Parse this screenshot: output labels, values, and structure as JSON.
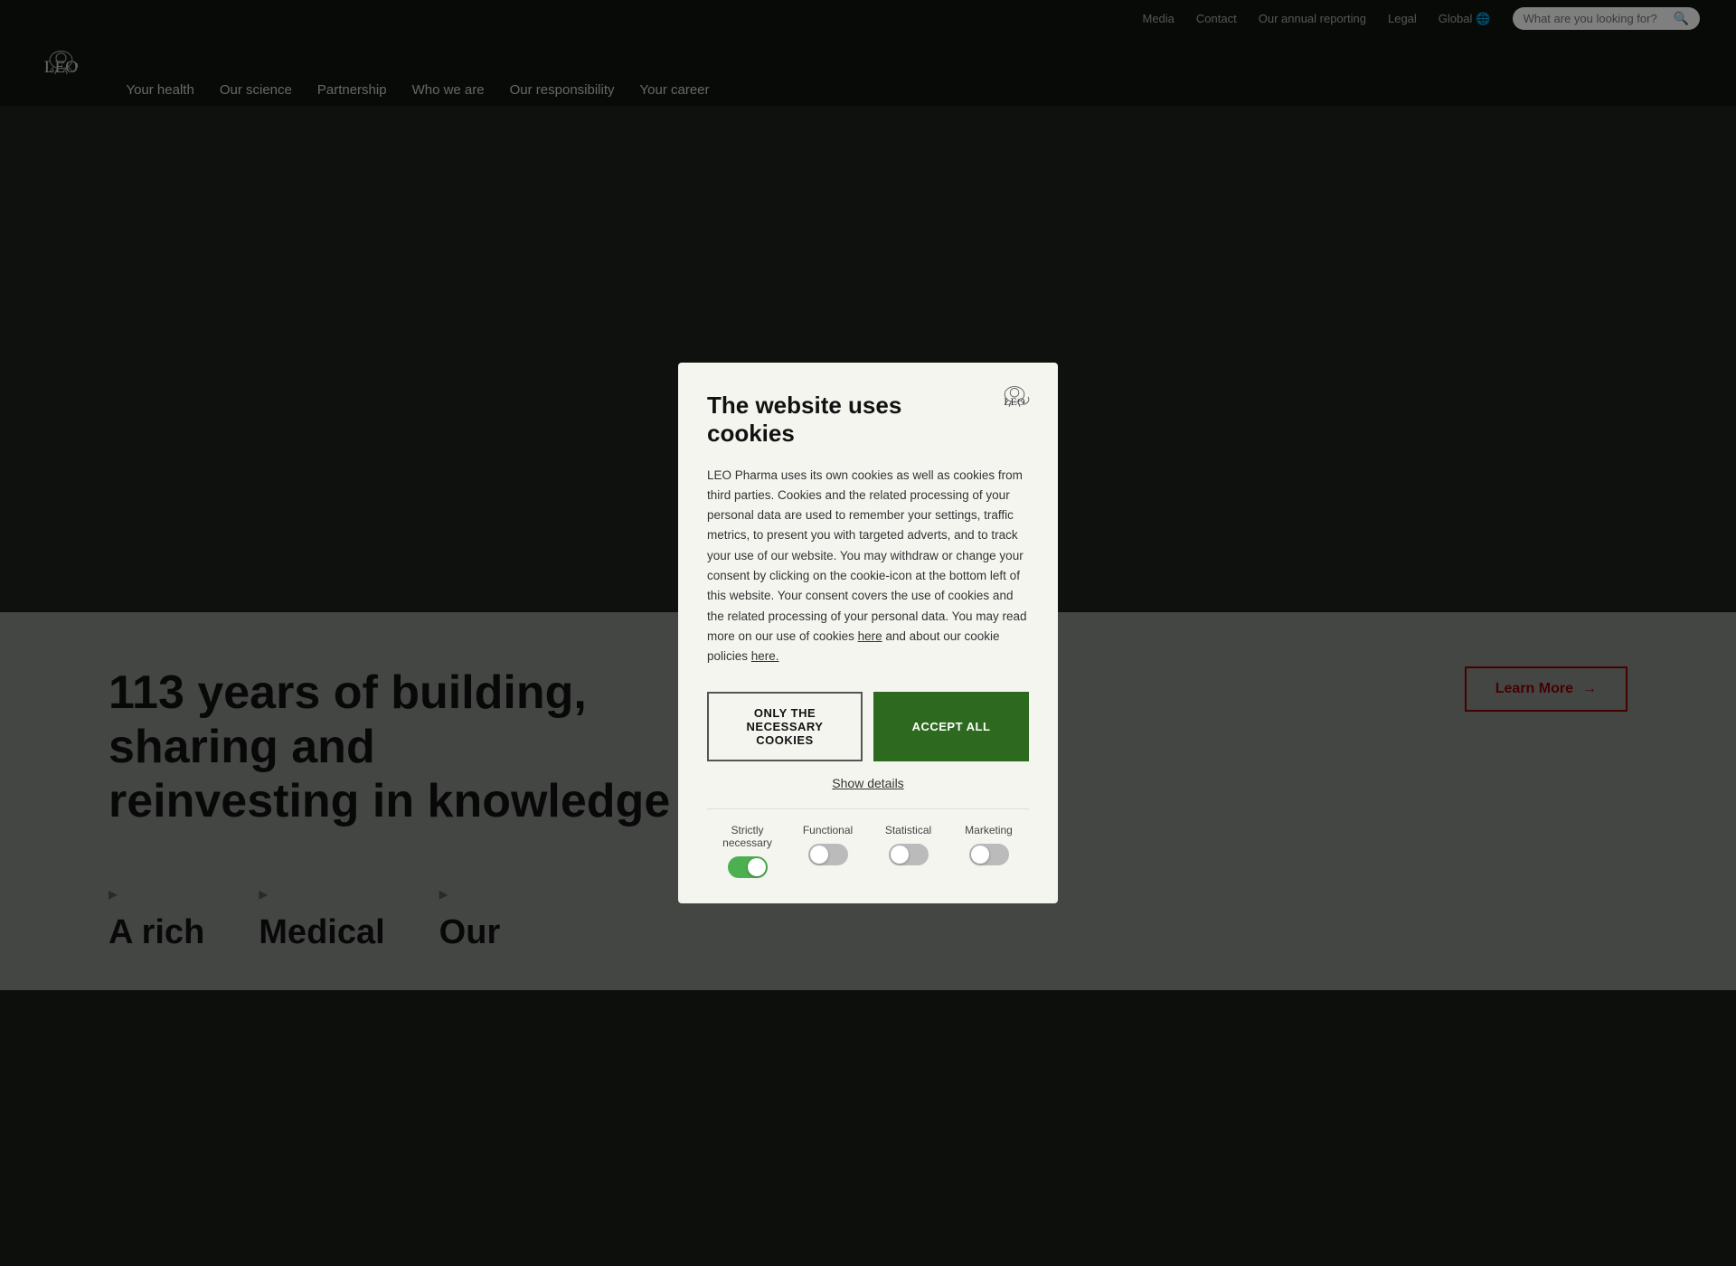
{
  "topbar": {
    "links": [
      {
        "label": "Media",
        "key": "media"
      },
      {
        "label": "Contact",
        "key": "contact"
      },
      {
        "label": "Our annual reporting",
        "key": "annual-reporting"
      },
      {
        "label": "Legal",
        "key": "legal"
      },
      {
        "label": "Global",
        "key": "global"
      }
    ],
    "search_placeholder": "What are you looking for?"
  },
  "nav": {
    "links": [
      {
        "label": "Your health",
        "key": "your-health"
      },
      {
        "label": "Our science",
        "key": "our-science"
      },
      {
        "label": "Partnership",
        "key": "partnership"
      },
      {
        "label": "Who we are",
        "key": "who-we-are"
      },
      {
        "label": "Our responsibility",
        "key": "our-responsibility"
      },
      {
        "label": "Your career",
        "key": "your-career"
      }
    ]
  },
  "cookie_modal": {
    "title": "The website uses cookies",
    "body": "LEO Pharma uses its own cookies as well as cookies from third parties. Cookies and the related processing of your personal data are used to remember your settings, traffic metrics, to present you with targeted adverts, and to track your use of our website. You may withdraw or change your consent by clicking on the cookie-icon at the bottom left of this website. Your consent covers the use of cookies and the related processing of your personal data. You may read more on our use of cookies ",
    "here1": "here",
    "body2": " and about our cookie policies ",
    "here2": "here.",
    "btn_necessary": "ONLY THE NECESSARY COOKIES",
    "btn_accept": "ACCEPT ALL",
    "show_details": "Show details",
    "toggles": [
      {
        "label": "Strictly necessary",
        "enabled": true
      },
      {
        "label": "Functional",
        "enabled": false
      },
      {
        "label": "Statistical",
        "enabled": false
      },
      {
        "label": "Marketing",
        "enabled": false
      }
    ]
  },
  "bottom": {
    "heading_line1": "113 years of building, sharing and",
    "heading_line2": "reinvesting in knowledge",
    "learn_more": "Learn More",
    "cards": [
      {
        "title": "A rich",
        "icon": "▸"
      },
      {
        "title": "Medical",
        "icon": "▸"
      },
      {
        "title": "Our",
        "icon": "▸"
      }
    ]
  }
}
